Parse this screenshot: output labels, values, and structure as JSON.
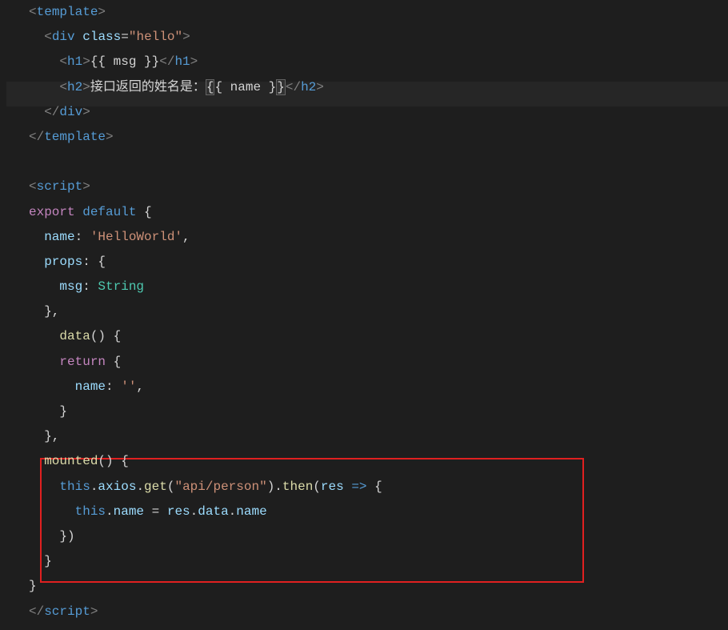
{
  "code": {
    "line1": {
      "tag": "template"
    },
    "line2": {
      "tag": "div",
      "attr": "class",
      "value": "\"hello\""
    },
    "line3": {
      "tag": "h1",
      "interp": "{{ msg }}"
    },
    "line4": {
      "tag": "h2",
      "text": "接口返回的姓名是：",
      "interp_open": "{",
      "interp_mid": "{ name }",
      "interp_close": "}"
    },
    "line5": {
      "closetag": "div"
    },
    "line6": {
      "closetag": "template"
    },
    "line8": {
      "tag": "script"
    },
    "line9": {
      "kw1": "export",
      "kw2": "default",
      "brace": " {"
    },
    "line10": {
      "prop": "name",
      "colon": ": ",
      "str": "'HelloWorld'",
      "comma": ","
    },
    "line11": {
      "prop": "props",
      "rest": ": {"
    },
    "line12": {
      "prop": "msg",
      "colon": ": ",
      "type": "String"
    },
    "line13": {
      "text": "},"
    },
    "line14": {
      "fn": "data",
      "rest": "() {"
    },
    "line15": {
      "kw": "return",
      "rest": " {"
    },
    "line16": {
      "prop": "name",
      "colon": ": ",
      "str": "''",
      "comma": ","
    },
    "line17": {
      "text": "}"
    },
    "line18": {
      "text": "},"
    },
    "line19": {
      "fn": "mounted",
      "rest": "() {"
    },
    "line20": {
      "this": "this",
      "dot1": ".",
      "axios": "axios",
      "dot2": ".",
      "get": "get",
      "p1": "(",
      "str": "\"api/person\"",
      "p2": ").",
      "then": "then",
      "p3": "(",
      "res": "res",
      "arrow": " => ",
      "brace": "{"
    },
    "line21": {
      "this": "this",
      "dot": ".",
      "name": "name",
      "eq": " = ",
      "res": "res",
      "dot2": ".",
      "data": "data",
      "dot3": ".",
      "name2": "name"
    },
    "line22": {
      "text": "})"
    },
    "line23": {
      "text": "}"
    },
    "line24": {
      "text": "}"
    },
    "line25": {
      "closetag": "script"
    }
  }
}
